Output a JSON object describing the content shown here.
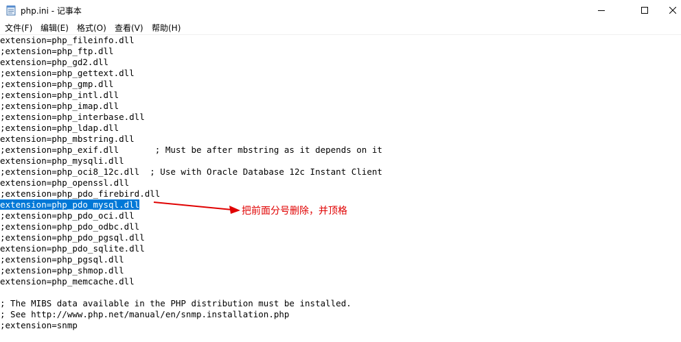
{
  "window": {
    "title": "php.ini - 记事本"
  },
  "menu": {
    "items": [
      {
        "label": "文件(F)"
      },
      {
        "label": "编辑(E)"
      },
      {
        "label": "格式(O)"
      },
      {
        "label": "查看(V)"
      },
      {
        "label": "帮助(H)"
      }
    ]
  },
  "editor": {
    "lines": [
      "extension=php_fileinfo.dll",
      ";extension=php_ftp.dll",
      "extension=php_gd2.dll",
      ";extension=php_gettext.dll",
      ";extension=php_gmp.dll",
      ";extension=php_intl.dll",
      ";extension=php_imap.dll",
      ";extension=php_interbase.dll",
      ";extension=php_ldap.dll",
      "extension=php_mbstring.dll",
      ";extension=php_exif.dll       ; Must be after mbstring as it depends on it",
      "extension=php_mysqli.dll",
      ";extension=php_oci8_12c.dll  ; Use with Oracle Database 12c Instant Client",
      "extension=php_openssl.dll",
      ";extension=php_pdo_firebird.dll",
      "extension=php_pdo_mysql.dll",
      ";extension=php_pdo_oci.dll",
      ";extension=php_pdo_odbc.dll",
      ";extension=php_pdo_pgsql.dll",
      "extension=php_pdo_sqlite.dll",
      ";extension=php_pgsql.dll",
      ";extension=php_shmop.dll",
      "extension=php_memcache.dll",
      "",
      "; The MIBS data available in the PHP distribution must be installed.",
      "; See http://www.php.net/manual/en/snmp.installation.php",
      ";extension=snmp"
    ],
    "selected_line_index": 15
  },
  "annotation": {
    "text": "把前面分号删除，并顶格",
    "color": "#e00000"
  },
  "colors": {
    "selection": "#0078d7",
    "annotation": "#e00000"
  },
  "icons": {
    "app": "notepad-icon",
    "minimize": "minimize-icon",
    "maximize": "maximize-icon",
    "close": "close-icon",
    "arrow": "red-arrow-icon"
  }
}
